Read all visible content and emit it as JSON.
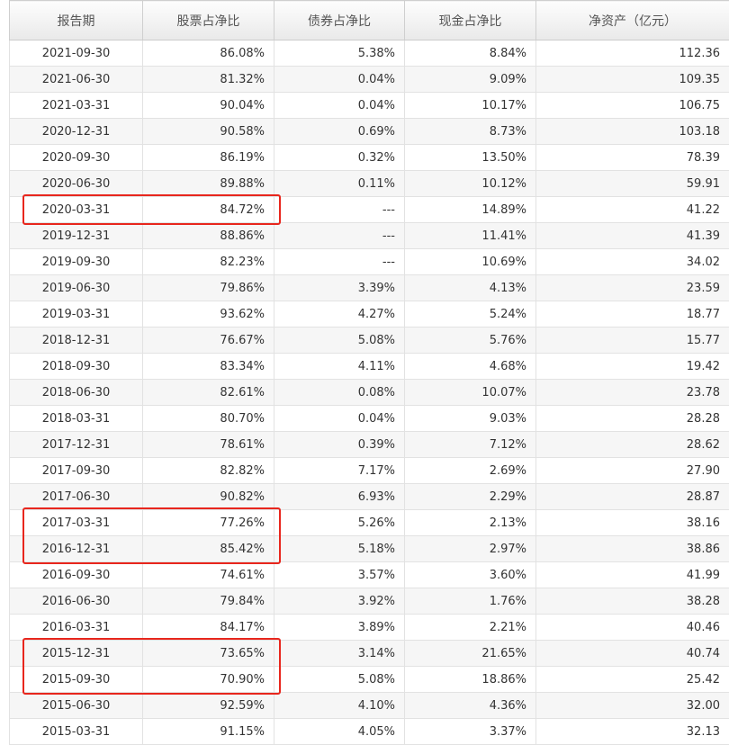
{
  "table": {
    "headers": [
      "报告期",
      "股票占净比",
      "债券占净比",
      "现金占净比",
      "净资产（亿元）"
    ],
    "rows": [
      [
        "2021-09-30",
        "86.08%",
        "5.38%",
        "8.84%",
        "112.36"
      ],
      [
        "2021-06-30",
        "81.32%",
        "0.04%",
        "9.09%",
        "109.35"
      ],
      [
        "2021-03-31",
        "90.04%",
        "0.04%",
        "10.17%",
        "106.75"
      ],
      [
        "2020-12-31",
        "90.58%",
        "0.69%",
        "8.73%",
        "103.18"
      ],
      [
        "2020-09-30",
        "86.19%",
        "0.32%",
        "13.50%",
        "78.39"
      ],
      [
        "2020-06-30",
        "89.88%",
        "0.11%",
        "10.12%",
        "59.91"
      ],
      [
        "2020-03-31",
        "84.72%",
        "---",
        "14.89%",
        "41.22"
      ],
      [
        "2019-12-31",
        "88.86%",
        "---",
        "11.41%",
        "41.39"
      ],
      [
        "2019-09-30",
        "82.23%",
        "---",
        "10.69%",
        "34.02"
      ],
      [
        "2019-06-30",
        "79.86%",
        "3.39%",
        "4.13%",
        "23.59"
      ],
      [
        "2019-03-31",
        "93.62%",
        "4.27%",
        "5.24%",
        "18.77"
      ],
      [
        "2018-12-31",
        "76.67%",
        "5.08%",
        "5.76%",
        "15.77"
      ],
      [
        "2018-09-30",
        "83.34%",
        "4.11%",
        "4.68%",
        "19.42"
      ],
      [
        "2018-06-30",
        "82.61%",
        "0.08%",
        "10.07%",
        "23.78"
      ],
      [
        "2018-03-31",
        "80.70%",
        "0.04%",
        "9.03%",
        "28.28"
      ],
      [
        "2017-12-31",
        "78.61%",
        "0.39%",
        "7.12%",
        "28.62"
      ],
      [
        "2017-09-30",
        "82.82%",
        "7.17%",
        "2.69%",
        "27.90"
      ],
      [
        "2017-06-30",
        "90.82%",
        "6.93%",
        "2.29%",
        "28.87"
      ],
      [
        "2017-03-31",
        "77.26%",
        "5.26%",
        "2.13%",
        "38.16"
      ],
      [
        "2016-12-31",
        "85.42%",
        "5.18%",
        "2.97%",
        "38.86"
      ],
      [
        "2016-09-30",
        "74.61%",
        "3.57%",
        "3.60%",
        "41.99"
      ],
      [
        "2016-06-30",
        "79.84%",
        "3.92%",
        "1.76%",
        "38.28"
      ],
      [
        "2016-03-31",
        "84.17%",
        "3.89%",
        "2.21%",
        "40.46"
      ],
      [
        "2015-12-31",
        "73.65%",
        "3.14%",
        "21.65%",
        "40.74"
      ],
      [
        "2015-09-30",
        "70.90%",
        "5.08%",
        "18.86%",
        "25.42"
      ],
      [
        "2015-06-30",
        "92.59%",
        "4.10%",
        "4.36%",
        "32.00"
      ],
      [
        "2015-03-31",
        "91.15%",
        "4.05%",
        "3.37%",
        "32.13"
      ],
      [
        "",
        "",
        "",
        "",
        ""
      ]
    ]
  },
  "highlights": {
    "color": "#e8261d",
    "groups": [
      [
        6
      ],
      [
        18,
        19
      ],
      [
        23,
        24
      ]
    ]
  }
}
